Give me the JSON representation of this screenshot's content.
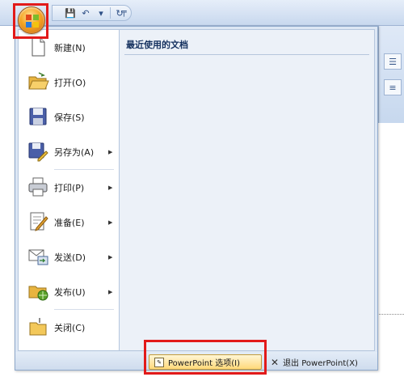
{
  "quick_access": {
    "buttons": [
      {
        "name": "save-icon",
        "glyph": "💾"
      },
      {
        "name": "undo-icon",
        "glyph": "↶"
      },
      {
        "name": "dropdown-arrow-icon",
        "glyph": "▾"
      },
      {
        "name": "redo-icon",
        "glyph": "↻"
      }
    ],
    "customize_glyph": "╤"
  },
  "menu": {
    "items": [
      {
        "label": "新建(N)",
        "icon": "new-document-icon",
        "has_submenu": false
      },
      {
        "label": "打开(O)",
        "icon": "open-folder-icon",
        "has_submenu": false
      },
      {
        "label": "保存(S)",
        "icon": "save-disk-icon",
        "has_submenu": false
      },
      {
        "label": "另存为(A)",
        "icon": "save-as-icon",
        "has_submenu": true
      },
      {
        "label": "打印(P)",
        "icon": "printer-icon",
        "has_submenu": true
      },
      {
        "label": "准备(E)",
        "icon": "prepare-icon",
        "has_submenu": true
      },
      {
        "label": "发送(D)",
        "icon": "send-icon",
        "has_submenu": true
      },
      {
        "label": "发布(U)",
        "icon": "publish-icon",
        "has_submenu": true
      },
      {
        "label": "关闭(C)",
        "icon": "close-folder-icon",
        "has_submenu": false
      }
    ],
    "submenu_arrow": "▶",
    "recent_title": "最近使用的文档"
  },
  "footer": {
    "options_label": "PowerPoint 选项(I)",
    "options_icon_glyph": "✎",
    "exit_label": "退出 PowerPoint(X)",
    "exit_icon_glyph": "✕"
  },
  "ribbon_peek": {
    "button1_glyph": "☰",
    "button2_glyph": "≡"
  },
  "colors": {
    "highlight": "#e21a1a",
    "menu_background": "#dde7f4",
    "options_button": "#ffd97a"
  }
}
